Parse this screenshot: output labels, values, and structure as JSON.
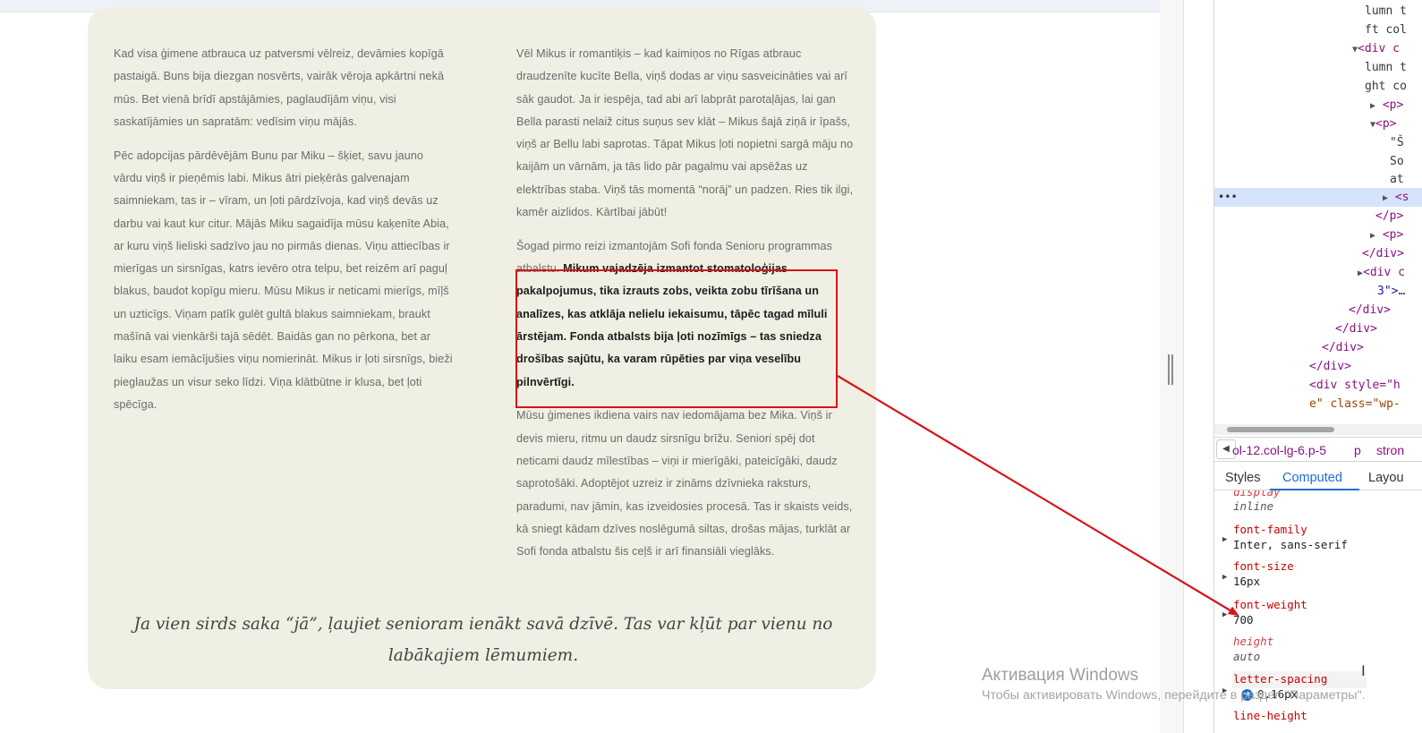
{
  "article": {
    "left_paragraphs": [
      "Kad visa ģimene atbrauca uz patversmi vēlreiz, devāmies kopīgā pastaigā. Buns bija diezgan nosvērts, vairāk vēroja apkārtni nekā mūs. Bet vienā brīdī apstājāmies, paglaudījām viņu, visi saskatījāmies un sapratām: vedīsim viņu mājās.",
      "Pēc adopcijas pārdēvējām Bunu par Miku – šķiet, savu jauno vārdu viņš ir pieņēmis labi. Mikus ātri pieķērās galvenajam saimniekam, tas ir – vīram, un ļoti pārdzīvoja, kad viņš devās uz darbu vai kaut kur citur. Mājās Miku sagaidīja mūsu kaķenīte Abia, ar kuru viņš lieliski sadzīvo jau no pirmās dienas. Viņu attiecības ir mierīgas un sirsnīgas, katrs ievēro otra telpu, bet reizēm arī paguļ blakus, baudot kopīgu mieru. Mūsu Mikus ir neticami mierīgs, mīļš un uzticīgs. Viņam patīk gulēt gultā blakus saimniekam, braukt mašīnā vai vienkārši tajā sēdēt. Baidās gan no pērkona, bet ar laiku esam iemācījušies viņu nomierināt. Mikus ir ļoti sirsnīgs, bieži pieglaužas un visur seko līdzi. Viņa klātbūtne ir klusa, bet ļoti spēcīga."
    ],
    "right_paragraph_1": "Vēl Mikus ir romantiķis – kad kaimiņos no Rīgas atbrauc draudzenīte kucīte Bella, viņš dodas ar viņu sasveicināties vai arī sāk gaudot. Ja ir iespēja, tad abi arī labprāt parotaļājas, lai gan Bella parasti nelaiž citus suņus sev klāt – Mikus šajā ziņā ir īpašs, viņš ar Bellu labi saprotas. Tāpat Mikus ļoti nopietni sargā māju no kaijām un vārnām, ja tās lido pār pagalmu vai apsēžas uz elektrības staba. Viņš tās momentā “norāj” un padzen. Ries tik ilgi, kamēr aizlidos. Kārtībai jābūt!",
    "right_paragraph_2_lead": "Šogad pirmo reizi izmantojām Sofi fonda Senioru programmas atbalstu. ",
    "right_paragraph_2_strong": "Mikum vajadzēja izmantot stomatoloģijas pakalpojumus, tika izrauts zobs, veikta zobu tīrīšana un analīzes, kas atklāja nelielu iekaisumu, tāpēc tagad mīluli ārstējam. Fonda atbalsts bija ļoti nozīmīgs – tas sniedza drošības sajūtu, ka varam rūpēties par viņa veselību pilnvērtīgi.",
    "right_paragraph_3": "Mūsu ģimenes ikdiena vairs nav iedomājama bez Mika. Viņš ir devis mieru, ritmu un daudz sirsnīgu brīžu. Seniori spēj dot neticami daudz mīlestības – viņi ir mierīgāki, pateicīgāki, daudz saprotošāki. Adoptējot uzreiz ir zināms dzīvnieka raksturs, paradumi, nav jāmin, kas izveidosies procesā. Tas ir skaists veids, kā sniegt kādam dzīves noslēgumā siltas, drošas mājas, turklāt ar Sofi fonda atbalstu šis ceļš ir arī finansiāli vieglāks.",
    "quote": "Ja vien sirds saka “jā”, ļaujiet senioram ienākt savā dzīvē. Tas var kļūt par vienu no labākajiem lēmumiem."
  },
  "devtools": {
    "dom_lines": [
      {
        "text": "lumn t"
      },
      {
        "text": "ft col"
      },
      {
        "text": "<div c"
      },
      {
        "text": "lumn t"
      },
      {
        "text": "ght co"
      },
      {
        "text": "<p>"
      },
      {
        "text": "<p>"
      },
      {
        "text": "\"Š"
      },
      {
        "text": "So"
      },
      {
        "text": "at"
      },
      {
        "text": "<s"
      },
      {
        "text": "</p>"
      },
      {
        "text": "<p>"
      },
      {
        "text": "</div>"
      },
      {
        "text": "<div c"
      },
      {
        "text": "3\">"
      },
      {
        "text": "</div>"
      },
      {
        "text": "</div>"
      },
      {
        "text": "</div>"
      },
      {
        "text": "</div>"
      },
      {
        "text": "<div style=\"h"
      },
      {
        "text": "e\" class=\"wp-"
      }
    ],
    "ellipsis": "…",
    "selected_dots": "•••",
    "breadcrumb": [
      {
        "text": "ol-12.col-lg-6.p-5"
      },
      {
        "text": "p"
      },
      {
        "text": "stron"
      }
    ],
    "breadcrumb_arrow": "◀",
    "tabs": [
      {
        "label": "Styles"
      },
      {
        "label": "Computed"
      },
      {
        "label": "Layou"
      }
    ],
    "computed": [
      {
        "name": "display",
        "value": "inline",
        "inherited": true
      },
      {
        "name": "font-family",
        "value": "Inter, sans-serif",
        "inherited": false
      },
      {
        "name": "font-size",
        "value": "16px",
        "inherited": false
      },
      {
        "name": "font-weight",
        "value": "700",
        "inherited": false
      },
      {
        "name": "height",
        "value": "auto",
        "inherited": true
      },
      {
        "name": "letter-spacing",
        "value": "0.16px",
        "inherited": false
      },
      {
        "name": "line-height",
        "value": "",
        "inherited": false
      }
    ]
  },
  "watermark": {
    "title": "Активация Windows",
    "subtitle": "Чтобы активировать Windows, перейдите в раздел \"Параметры\"."
  },
  "colors": {
    "card_background": "#f0efe4",
    "annotation_red": "#d81414",
    "devtools_accent": "#1a6fd1"
  }
}
